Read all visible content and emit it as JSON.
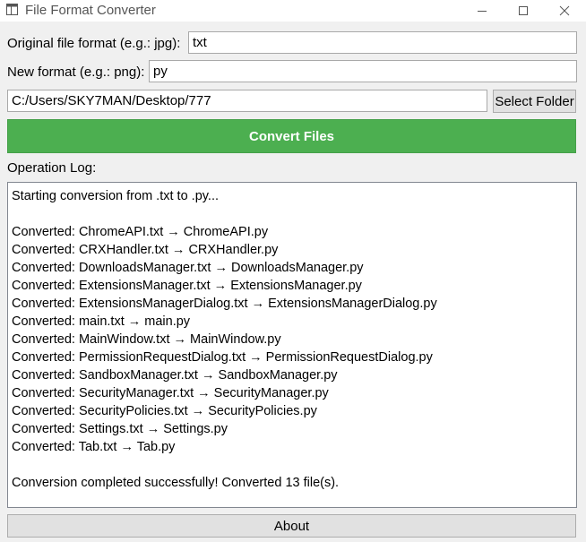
{
  "window": {
    "title": "File Format Converter"
  },
  "form": {
    "original_label": "Original file format (e.g.: jpg):",
    "original_value": "txt",
    "new_label": "New format (e.g.: png):",
    "new_value": "py",
    "folder_value": "C:/Users/SKY7MAN/Desktop/777",
    "select_folder_label": "Select Folder",
    "convert_label": "Convert Files"
  },
  "log": {
    "label": "Operation Log:",
    "lines": [
      "Starting conversion from .txt to .py...",
      "",
      "Converted: ChromeAPI.txt → ChromeAPI.py",
      "Converted: CRXHandler.txt → CRXHandler.py",
      "Converted: DownloadsManager.txt → DownloadsManager.py",
      "Converted: ExtensionsManager.txt → ExtensionsManager.py",
      "Converted: ExtensionsManagerDialog.txt → ExtensionsManagerDialog.py",
      "Converted: main.txt → main.py",
      "Converted: MainWindow.txt → MainWindow.py",
      "Converted: PermissionRequestDialog.txt → PermissionRequestDialog.py",
      "Converted: SandboxManager.txt → SandboxManager.py",
      "Converted: SecurityManager.txt → SecurityManager.py",
      "Converted: SecurityPolicies.txt → SecurityPolicies.py",
      "Converted: Settings.txt → Settings.py",
      "Converted: Tab.txt → Tab.py",
      "",
      "Conversion completed successfully! Converted 13 file(s)."
    ]
  },
  "footer": {
    "about_label": "About"
  },
  "colors": {
    "accent": "#4caf50",
    "background": "#f0f0f0"
  }
}
